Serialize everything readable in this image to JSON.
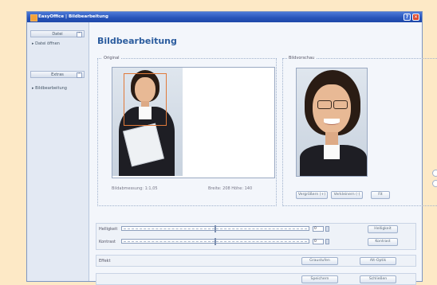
{
  "window": {
    "title": "EasyOffice | Bildbearbeitung",
    "help_glyph": "?",
    "close_glyph": "✕"
  },
  "sidebar": {
    "sections": [
      {
        "label": "Datei",
        "toggle": "⌃",
        "items": [
          "Datei öffnen"
        ]
      },
      {
        "label": "Extras",
        "toggle": "⌃",
        "items": [
          "Bildbearbeitung"
        ]
      }
    ]
  },
  "main": {
    "title": "Bildbearbeitung",
    "original": {
      "legend": "Original",
      "info_left": "Bildabmessung: 1:1,05",
      "info_right": "Breite: 208  Höhe: 140"
    },
    "preview": {
      "legend": "Bildvorschau",
      "buttons": [
        "Vergrößern (+)",
        "Verkleinern (-)",
        "Fit"
      ]
    },
    "adjust": {
      "rows": [
        {
          "label": "Helligkeit",
          "value": "0",
          "button": "Helligkeit"
        },
        {
          "label": "Kontrast",
          "value": "0",
          "button": "Kontrast"
        }
      ]
    },
    "effects": {
      "label": "Effekt",
      "buttons": [
        "Graustufen",
        "Alt-Optik"
      ]
    },
    "footer": {
      "buttons": [
        "Speichern",
        "Schließen"
      ]
    }
  }
}
